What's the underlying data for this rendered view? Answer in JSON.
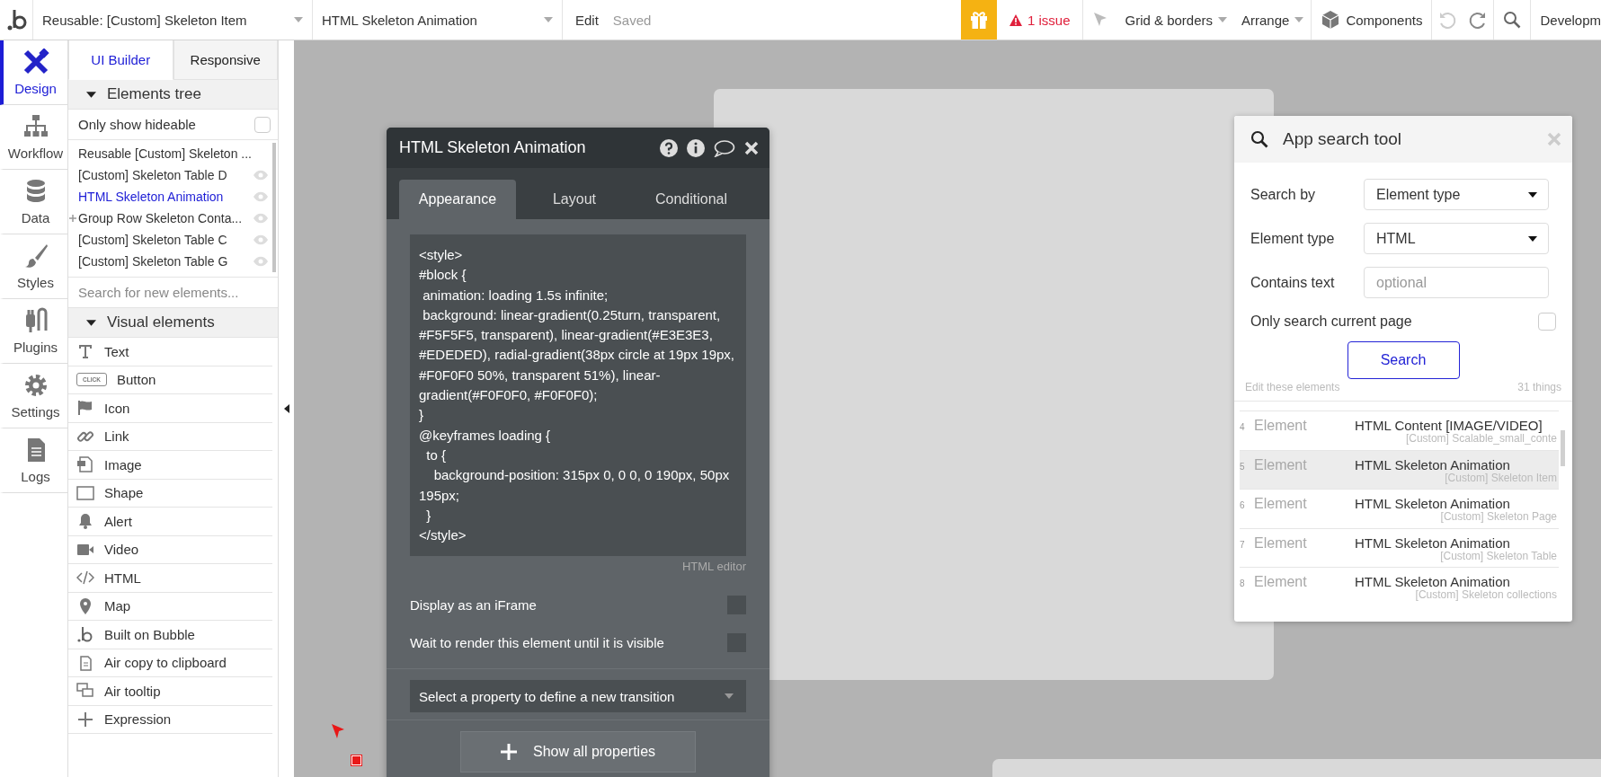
{
  "topbar": {
    "page_dropdown": "Reusable: [Custom] Skeleton Item",
    "element_dropdown": "HTML Skeleton Animation",
    "edit": "Edit",
    "saved": "Saved",
    "issues": "1 issue",
    "grid": "Grid & borders",
    "arrange": "Arrange",
    "components": "Components",
    "environment": "Developm"
  },
  "nav": [
    {
      "label": "Design",
      "selected": true
    },
    {
      "label": "Workflow",
      "selected": false
    },
    {
      "label": "Data",
      "selected": false
    },
    {
      "label": "Styles",
      "selected": false
    },
    {
      "label": "Plugins",
      "selected": false
    },
    {
      "label": "Settings",
      "selected": false
    },
    {
      "label": "Logs",
      "selected": false
    }
  ],
  "palette": {
    "tabs": [
      {
        "label": "UI Builder",
        "selected": true
      },
      {
        "label": "Responsive",
        "selected": false
      }
    ],
    "tree_header": "Elements tree",
    "hideable": {
      "label": "Only show hideable",
      "checked": false
    },
    "tree_items": [
      {
        "label": "Reusable [Custom] Skeleton ...",
        "selected": false,
        "eye": false,
        "expandable": false
      },
      {
        "label": "[Custom] Skeleton Table D",
        "selected": false,
        "eye": true,
        "expandable": false
      },
      {
        "label": "HTML Skeleton Animation",
        "selected": true,
        "eye": true,
        "expandable": false
      },
      {
        "label": "Group Row Skeleton Conta...",
        "selected": false,
        "eye": true,
        "expandable": true
      },
      {
        "label": "[Custom] Skeleton Table C",
        "selected": false,
        "eye": true,
        "expandable": false
      },
      {
        "label": "[Custom] Skeleton Table G",
        "selected": false,
        "eye": true,
        "expandable": false
      }
    ],
    "search_placeholder": "Search for new elements...",
    "visual_header": "Visual elements",
    "elements": [
      {
        "label": "Text"
      },
      {
        "label": "Button",
        "icon_text": "CLICK"
      },
      {
        "label": "Icon"
      },
      {
        "label": "Link"
      },
      {
        "label": "Image"
      },
      {
        "label": "Shape"
      },
      {
        "label": "Alert"
      },
      {
        "label": "Video"
      },
      {
        "label": "HTML"
      },
      {
        "label": "Map"
      },
      {
        "label": "Built on Bubble"
      },
      {
        "label": "Air copy to clipboard"
      },
      {
        "label": "Air tooltip"
      },
      {
        "label": "Expression"
      }
    ]
  },
  "property_panel": {
    "title": "HTML Skeleton Animation",
    "tabs": [
      {
        "label": "Appearance",
        "selected": true
      },
      {
        "label": "Layout",
        "selected": false
      },
      {
        "label": "Conditional",
        "selected": false
      }
    ],
    "code": "<style>\n#block {\n animation: loading 1.5s infinite;\n background: linear-gradient(0.25turn, transparent, #F5F5F5, transparent), linear-gradient(#E3E3E3, #EDEDED), radial-gradient(38px circle at 19px 19px, #F0F0F0 50%, transparent 51%), linear-gradient(#F0F0F0, #F0F0F0);\n}\n@keyframes loading {\n  to {\n    background-position: 315px 0, 0 0, 0 190px, 50px 195px;\n  }\n</style>",
    "editor_label": "HTML editor",
    "options": [
      {
        "label": "Display as an iFrame",
        "checked": false
      },
      {
        "label": "Wait to render this element until it is visible",
        "checked": false
      }
    ],
    "transition_select": "Select a property to define a new transition",
    "show_all": "Show all properties"
  },
  "search_tool": {
    "title": "App search tool",
    "fields": [
      {
        "label": "Search by",
        "kind": "select",
        "value": "Element type"
      },
      {
        "label": "Element type",
        "kind": "select",
        "value": "HTML"
      },
      {
        "label": "Contains text",
        "kind": "text",
        "placeholder": "optional"
      }
    ],
    "current_page": {
      "label": "Only search current page",
      "checked": false
    },
    "search_button": "Search",
    "results_label": "Edit these elements",
    "results_count": "31 things",
    "results": [
      {
        "index": "4",
        "type": "Element",
        "name": "HTML Content [IMAGE/VIDEO]",
        "parent": "[Custom] Scalable_small_conte",
        "selected": false
      },
      {
        "index": "5",
        "type": "Element",
        "name": "HTML Skeleton Animation",
        "parent": "[Custom] Skeleton Item",
        "selected": true
      },
      {
        "index": "6",
        "type": "Element",
        "name": "HTML Skeleton Animation",
        "parent": "[Custom] Skeleton Page",
        "selected": false
      },
      {
        "index": "7",
        "type": "Element",
        "name": "HTML Skeleton Animation",
        "parent": "[Custom] Skeleton Table",
        "selected": false
      },
      {
        "index": "8",
        "type": "Element",
        "name": "HTML Skeleton Animation",
        "parent": "[Custom] Skeleton collections",
        "selected": false
      }
    ]
  }
}
